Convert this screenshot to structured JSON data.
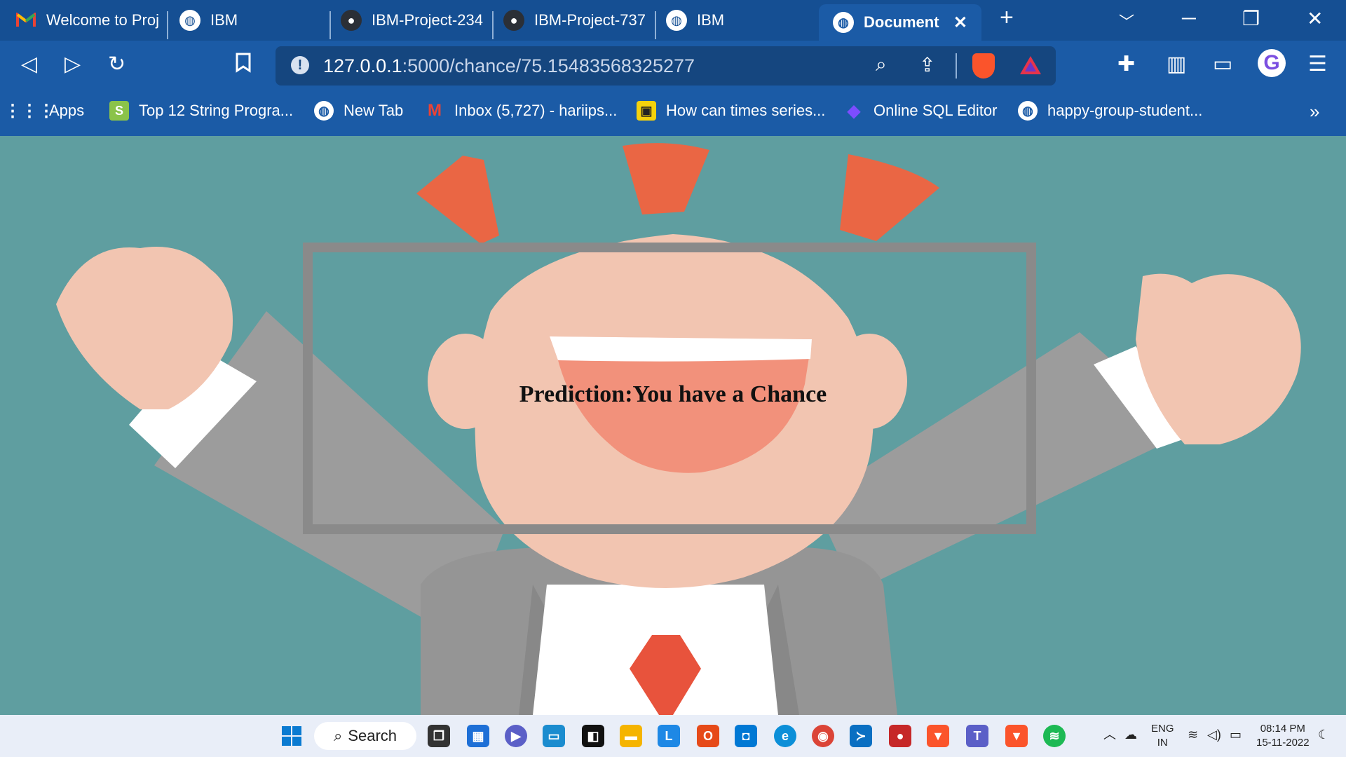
{
  "browser": {
    "tabs": [
      {
        "label": "Welcome to Proj",
        "icon": "gmail-icon"
      },
      {
        "label": "IBM",
        "icon": "globe-icon"
      },
      {
        "label": "IBM-Project-234",
        "icon": "github-icon"
      },
      {
        "label": "IBM-Project-737",
        "icon": "github-icon"
      },
      {
        "label": "IBM",
        "icon": "globe-icon"
      },
      {
        "label": "Document",
        "icon": "globe-icon",
        "active": true
      }
    ],
    "new_tab_glyph": "+",
    "close_tab_glyph": "✕",
    "url_host": "127.0.0.1",
    "url_path": ":5000/chance/75.15483568325277",
    "bookmarks": [
      {
        "label": "Apps"
      },
      {
        "label": "Top 12 String Progra..."
      },
      {
        "label": "New Tab"
      },
      {
        "label": "Inbox (5,727) - hariips..."
      },
      {
        "label": "How can times series..."
      },
      {
        "label": "Online SQL Editor"
      },
      {
        "label": "happy-group-student..."
      }
    ],
    "overflow_glyph": "»",
    "accent": "#1b5ba6"
  },
  "page": {
    "prediction_text": "Prediction:You have a Chance",
    "background": "#5f9ea0"
  },
  "taskbar": {
    "search_label": "Search",
    "lang_top": "ENG",
    "lang_bottom": "IN",
    "time": "08:14 PM",
    "date": "15-11-2022"
  }
}
